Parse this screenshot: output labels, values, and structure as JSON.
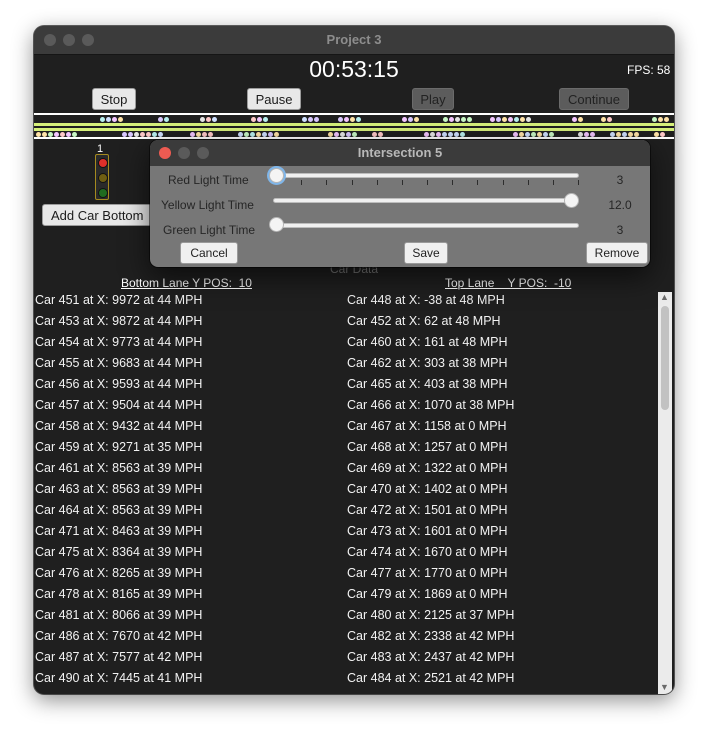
{
  "window": {
    "title": "Project 3"
  },
  "header": {
    "clock": "00:53:15",
    "fps": "FPS: 58"
  },
  "toolbar": {
    "stop": "Stop",
    "pause": "Pause",
    "play": "Play",
    "continue": "Continue"
  },
  "intersection_signal": {
    "label": "1",
    "lamp_icons": [
      "red-lamp-icon",
      "yellow-lamp-icon",
      "green-lamp-icon"
    ]
  },
  "controls": {
    "add_car_bottom": "Add Car Bottom"
  },
  "car_data": {
    "title": "Car Data",
    "bottom_lane_header": "Bottom Lane Y POS:  10",
    "top_lane_header": "Top Lane    Y POS:  -10",
    "bottom_lane": [
      "Car 451 at X: 9972 at 44 MPH",
      "Car 453 at X: 9872 at 44 MPH",
      "Car 454 at X: 9773 at 44 MPH",
      "Car 455 at X: 9683 at 44 MPH",
      "Car 456 at X: 9593 at 44 MPH",
      "Car 457 at X: 9504 at 44 MPH",
      "Car 458 at X: 9432 at 44 MPH",
      "Car 459 at X: 9271 at 35 MPH",
      "Car 461 at X: 8563 at 39 MPH",
      "Car 463 at X: 8563 at 39 MPH",
      "Car 464 at X: 8563 at 39 MPH",
      "Car 471 at X: 8463 at 39 MPH",
      "Car 475 at X: 8364 at 39 MPH",
      "Car 476 at X: 8265 at 39 MPH",
      "Car 478 at X: 8165 at 39 MPH",
      "Car 481 at X: 8066 at 39 MPH",
      "Car 486 at X: 7670 at 42 MPH",
      "Car 487 at X: 7577 at 42 MPH",
      "Car 490 at X: 7445 at 41 MPH"
    ],
    "top_lane": [
      "Car 448 at X: -38 at 48 MPH",
      "Car 452 at X: 62 at 48 MPH",
      "Car 460 at X: 161 at 48 MPH",
      "Car 462 at X: 303 at 38 MPH",
      "Car 465 at X: 403 at 38 MPH",
      "Car 466 at X: 1070 at 38 MPH",
      "Car 467 at X: 1158 at 0 MPH",
      "Car 468 at X: 1257 at 0 MPH",
      "Car 469 at X: 1322 at 0 MPH",
      "Car 470 at X: 1402 at 0 MPH",
      "Car 472 at X: 1501 at 0 MPH",
      "Car 473 at X: 1601 at 0 MPH",
      "Car 474 at X: 1670 at 0 MPH",
      "Car 477 at X: 1770 at 0 MPH",
      "Car 479 at X: 1869 at 0 MPH",
      "Car 480 at X: 2125 at 37 MPH",
      "Car 482 at X: 2338 at 42 MPH",
      "Car 483 at X: 2437 at 42 MPH",
      "Car 484 at X: 2521 at 42 MPH"
    ]
  },
  "dialog": {
    "title": "Intersection 5",
    "red_label": "Red Light Time",
    "yellow_label": "Yellow Light Time",
    "green_label": "Green Light Time",
    "red_value": "3",
    "yellow_value": "12.0",
    "green_value": "3",
    "slider_fraction": {
      "red": 0.0,
      "yellow": 1.0,
      "green": 0.0
    },
    "cancel": "Cancel",
    "save": "Save",
    "remove": "Remove"
  },
  "colors": {
    "window_bg": "#1f1f1f",
    "road_stripe": "#d6f07a",
    "dialog_bg": "#777777",
    "slider_focus": "#7fb6ea"
  }
}
